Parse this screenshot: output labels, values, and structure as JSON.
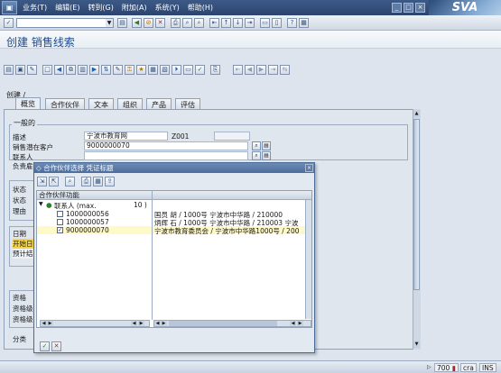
{
  "menubar": {
    "items": [
      "业务(T)",
      "编辑(E)",
      "转到(G)",
      "附加(A)",
      "系统(Y)",
      "帮助(H)"
    ],
    "logo": "SVA"
  },
  "command_field": {
    "value": ""
  },
  "title": "创建 销售线索",
  "breadcrumb": "创建 /",
  "tabs": [
    "概览",
    "合作伙伴",
    "文本",
    "组织",
    "产品",
    "评估"
  ],
  "general": {
    "group_title": "一般的",
    "labels": [
      "描述",
      "销售潜在客户",
      "联系人",
      "负责雇员"
    ],
    "description_value": "宁波市教育网",
    "description_code": "Z001",
    "prospect_value": "9000000070"
  },
  "left_labels": [
    "状态",
    "状态",
    "理由",
    "日期",
    "开始日",
    "预计结",
    "资格",
    "资格级",
    "资格级",
    "分类"
  ],
  "dialog": {
    "title": "合作伙伴选择 凭证标题",
    "column_header": "合作伙伴功能",
    "group_label": "联系人 (max.",
    "group_count": "10 )",
    "rows": [
      {
        "id": "1000000056",
        "checked": false,
        "detail": "国员 胡 / 1000号 宁波市中华路 / 210000"
      },
      {
        "id": "1000000057",
        "checked": false,
        "detail": "炳辉 石 / 1000号 宁波市中华路 / 210003 宁波"
      },
      {
        "id": "9000000070",
        "checked": true,
        "detail": "宁波市教育委员会 / 宁波市中华路1000号 / 200"
      }
    ]
  },
  "statusbar": {
    "server": "700",
    "client": "cra",
    "mode": "INS"
  },
  "icons": {
    "ok": "check-icon",
    "cancel": "cross-icon"
  }
}
